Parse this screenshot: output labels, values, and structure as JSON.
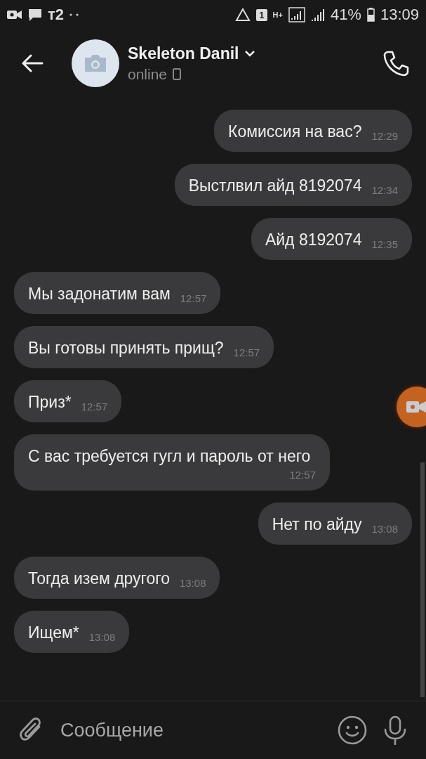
{
  "status_bar": {
    "carrier": "т2",
    "sim_slot": "1",
    "network_type": "H+",
    "battery": "41%",
    "time": "13:09"
  },
  "header": {
    "name": "Skeleton Danil",
    "status": "online"
  },
  "messages": [
    {
      "kind": "out",
      "text": "Комиссия на вас?",
      "time": "12:29"
    },
    {
      "kind": "out",
      "text": "Выстлвил айд 8192074",
      "time": "12:34"
    },
    {
      "kind": "out",
      "text": "Айд 8192074",
      "time": "12:35"
    },
    {
      "kind": "in",
      "text": "Мы задонатим вам",
      "time": "12:57"
    },
    {
      "kind": "in",
      "text": "Вы готовы принять прищ?",
      "time": "12:57"
    },
    {
      "kind": "in",
      "text": "Приз*",
      "time": "12:57"
    },
    {
      "kind": "in",
      "text": "С вас требуется гугл и пароль от него",
      "time": "12:57"
    },
    {
      "kind": "out",
      "text": "Нет по айду",
      "time": "13:08"
    },
    {
      "kind": "in",
      "text": "Тогда изем другого",
      "time": "13:08"
    },
    {
      "kind": "in",
      "text": "Ищем*",
      "time": "13:08"
    }
  ],
  "composer": {
    "placeholder": "Сообщение"
  }
}
